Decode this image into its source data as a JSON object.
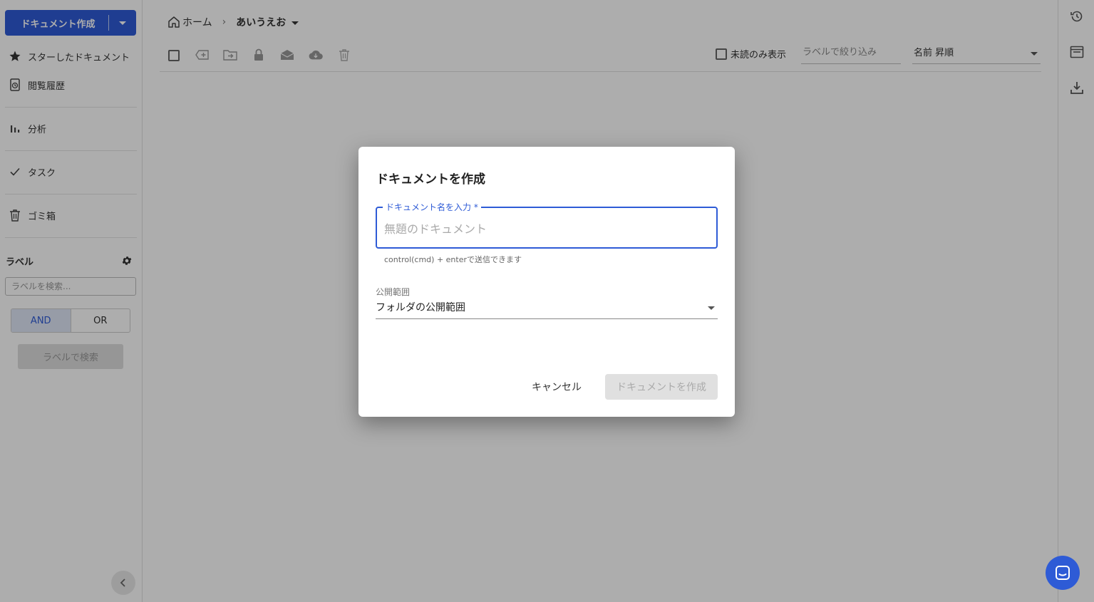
{
  "sidebar": {
    "create_button": "ドキュメント作成",
    "items": [
      {
        "label": "スターしたドキュメント",
        "icon": "star-icon"
      },
      {
        "label": "閲覧履歴",
        "icon": "history-icon"
      },
      {
        "label": "分析",
        "icon": "bar-chart-icon"
      },
      {
        "label": "タスク",
        "icon": "check-icon"
      },
      {
        "label": "ゴミ箱",
        "icon": "trash-icon"
      }
    ],
    "label_section": {
      "title": "ラベル",
      "search_placeholder": "ラベルを検索...",
      "and_label": "AND",
      "or_label": "OR",
      "search_button": "ラベルで検索"
    }
  },
  "breadcrumb": {
    "home": "ホーム",
    "current": "あいうえお"
  },
  "toolbar": {
    "unread_only": "未読のみ表示",
    "filter_placeholder": "ラベルで絞り込み",
    "sort_value": "名前 昇順"
  },
  "dialog": {
    "title": "ドキュメントを作成",
    "name_label": "ドキュメント名を入力",
    "required_mark": "*",
    "name_placeholder": "無題のドキュメント",
    "name_value": "",
    "helper_text": "control(cmd) + enterで送信できます",
    "visibility_label": "公開範囲",
    "visibility_value": "フォルダの公開範囲",
    "cancel_button": "キャンセル",
    "submit_button": "ドキュメントを作成"
  },
  "colors": {
    "primary": "#2e5bd6",
    "overlay": "rgba(0,0,0,0.32)"
  }
}
